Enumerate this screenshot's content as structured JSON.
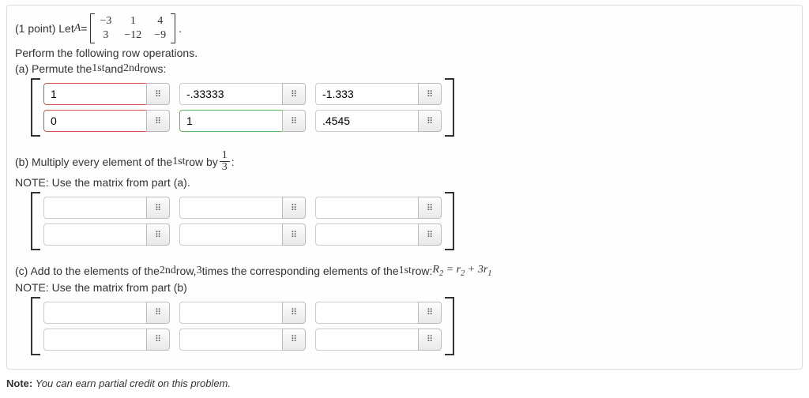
{
  "header": {
    "points_label": "(1 point) Let ",
    "var": "A",
    "equals": " = ",
    "matrix": [
      "−3",
      "1",
      "4",
      "3",
      "−12",
      "−9"
    ],
    "period": "."
  },
  "intro": "Perform the following row operations.",
  "parts": {
    "a": {
      "prompt_prefix": "(a) Permute the ",
      "first": "1st",
      "and": " and ",
      "second": "2nd",
      "prompt_suffix": " rows:",
      "values": [
        "1",
        "-.33333",
        "-1.333",
        "0",
        "1",
        ".4545"
      ],
      "states": [
        "invalid",
        "",
        "",
        "invalid",
        "valid",
        ""
      ]
    },
    "b": {
      "prefix": "(b) Multiply every element of the ",
      "first": "1st",
      "mid": " row by ",
      "frac_n": "1",
      "frac_d": "3",
      "suffix": ":",
      "note": "NOTE: Use the matrix from part (a).",
      "values": [
        "",
        "",
        "",
        "",
        "",
        ""
      ],
      "states": [
        "",
        "",
        "",
        "",
        "",
        ""
      ]
    },
    "c": {
      "prefix": "(c) Add to the elements of the ",
      "second": "2nd",
      "mid1": " row, ",
      "mult": "3",
      "mid2": " times the corresponding elements of the ",
      "first": "1st",
      "mid3": " row: ",
      "eq_R": "R",
      "eq_sub2a": "2",
      "eq_eq": " = ",
      "eq_r": "r",
      "eq_sub2b": "2",
      "eq_plus": " + 3",
      "eq_r2": "r",
      "eq_sub1": "1",
      "note": "NOTE: Use the matrix from part (b)",
      "values": [
        "",
        "",
        "",
        "",
        "",
        ""
      ],
      "states": [
        "",
        "",
        "",
        "",
        "",
        ""
      ]
    }
  },
  "keypad_glyph": "⠿",
  "footer": {
    "bold": "Note:",
    "text": " You can earn partial credit on this problem."
  }
}
